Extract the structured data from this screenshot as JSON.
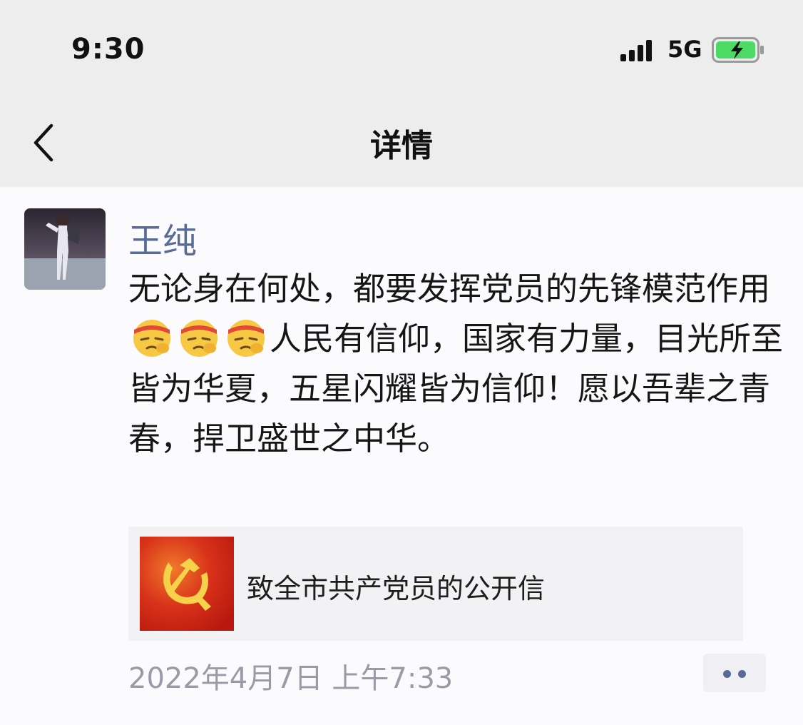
{
  "status_bar": {
    "time": "9:30",
    "network": "5G",
    "icons": [
      "signal-icon",
      "battery-charging-icon"
    ],
    "battery_color": "#4cd964"
  },
  "nav": {
    "title": "详情",
    "back_icon": "chevron-left-icon"
  },
  "post": {
    "author": "王纯",
    "author_color": "#586b97",
    "text_before_emoji": "无论身在何处，都要发挥党员的先锋模范作用",
    "emoji_icon": "determined-face-emoji",
    "emoji_count": 3,
    "text_after_emoji": "人民有信仰，国家有力量，目光所至皆为华夏，五星闪耀皆为信仰！愿以吾辈之青春，捍卫盛世之中华。",
    "link_card": {
      "title": "致全市共产党员的公开信",
      "thumb_icon": "party-emblem-icon"
    },
    "timestamp": "2022年4月7日 上午7:33",
    "more_icon": "more-dots-icon"
  }
}
